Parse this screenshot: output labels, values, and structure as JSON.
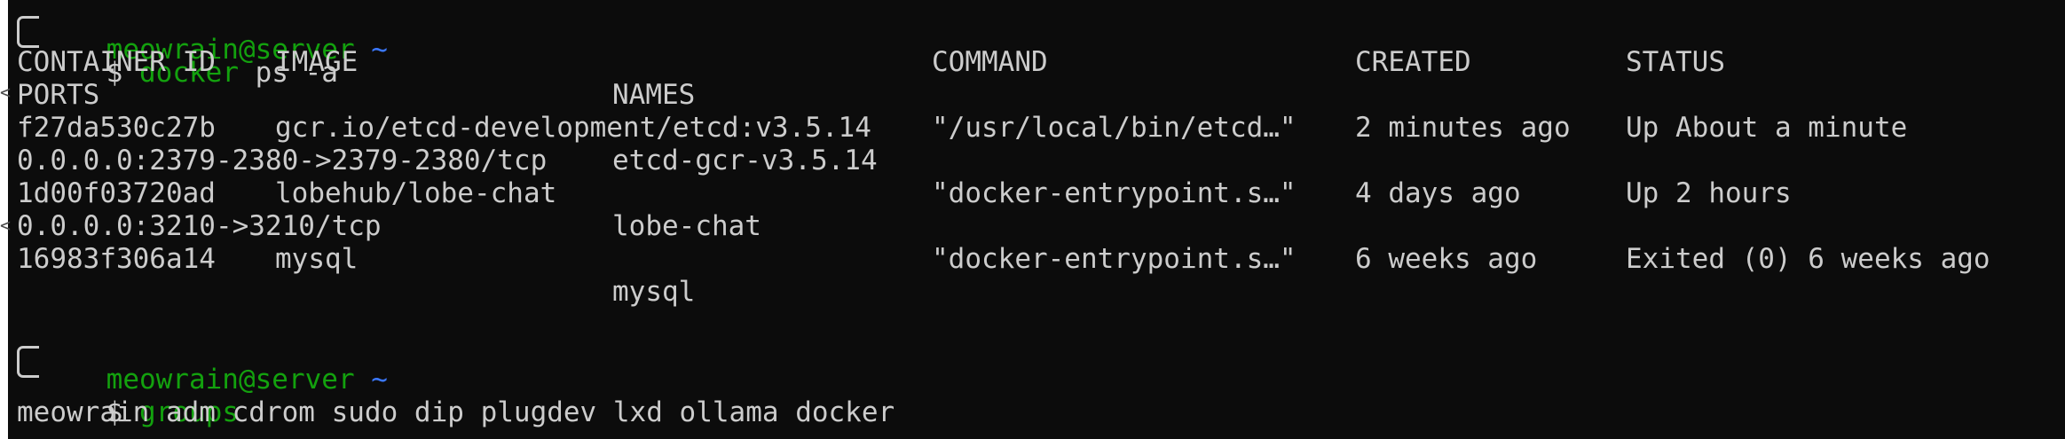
{
  "terminal": {
    "prompt_user": "meowrain@server",
    "prompt_dir": "~",
    "prompt_symbol": "$",
    "command1_name": "docker",
    "command1_args": " ps -a",
    "table": {
      "headers": {
        "container_id": "CONTAINER ID",
        "image": "IMAGE",
        "command": "COMMAND",
        "created": "CREATED",
        "status": "STATUS",
        "ports": "PORTS",
        "names": "NAMES"
      },
      "rows": [
        {
          "container_id": "f27da530c27b",
          "image": "gcr.io/etcd-development/etcd:v3.5.14",
          "command": "\"/usr/local/bin/etcd…\"",
          "created": "2 minutes ago",
          "status": "Up About a minute",
          "ports": "0.0.0.0:2379-2380->2379-2380/tcp",
          "names": "etcd-gcr-v3.5.14"
        },
        {
          "container_id": "1d00f03720ad",
          "image": "lobehub/lobe-chat",
          "command": "\"docker-entrypoint.s…\"",
          "created": "4 days ago",
          "status": "Up 2 hours",
          "ports": "0.0.0.0:3210->3210/tcp",
          "names": "lobe-chat"
        },
        {
          "container_id": "16983f306a14",
          "image": "mysql",
          "command": "\"docker-entrypoint.s…\"",
          "created": "6 weeks ago",
          "status": "Exited (0) 6 weeks ago",
          "ports": "",
          "names": "mysql"
        }
      ]
    },
    "command2_name": "groups",
    "groups_output": "meowrain adm cdrom sudo dip plugdev lxd ollama docker"
  },
  "colors": {
    "background": "#0c0c0c",
    "text": "#cccccc",
    "prompt_user": "#13a10e",
    "prompt_dir": "#3b78ff",
    "command": "#13a10e"
  }
}
